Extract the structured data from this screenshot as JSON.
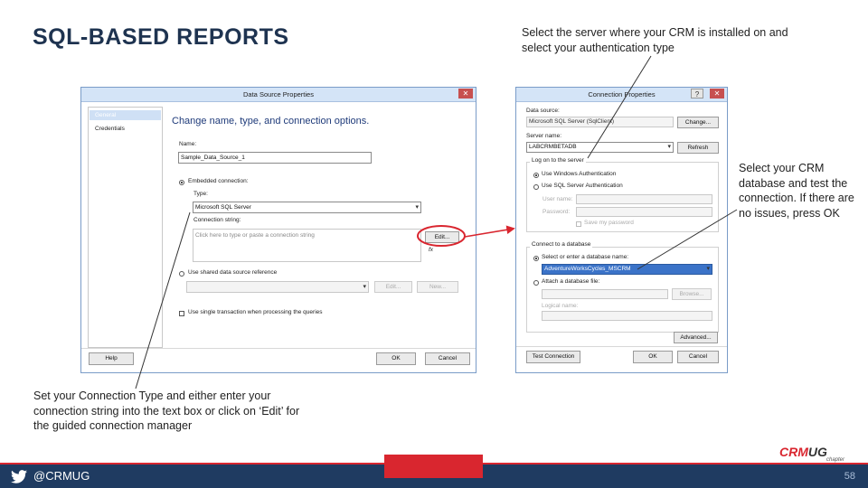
{
  "slide": {
    "title": "SQL-BASED REPORTS",
    "note_top": "Select the server where your CRM is installed on and select your authentication type",
    "note_right": "Select your CRM database and test the connection. If there are no issues, press OK",
    "note_bottom": "Set your Connection Type and either enter your connection string into the text box or click on ‘Edit’ for the guided connection manager",
    "twitter_handle": "@CRMUG",
    "page_number": "58",
    "logo_crm": "CRM",
    "logo_ug": "UG",
    "logo_sub": "chapter",
    "colors": {
      "title": "#1e3350",
      "accent_red": "#d9262f",
      "footer_navy": "#1f3b61",
      "arrow": "#d9262f"
    }
  },
  "dsp": {
    "window_title": "Data Source Properties",
    "close": "✕",
    "nav_items": [
      "General",
      "Credentials"
    ],
    "heading": "Change name, type, and connection options.",
    "name_label": "Name:",
    "name_value": "Sample_Data_Source_1",
    "embedded_label": "Embedded connection:",
    "type_label": "Type:",
    "type_value": "Microsoft SQL Server",
    "conn_label": "Connection string:",
    "conn_placeholder": "Click here to type or paste a connection string",
    "edit_button": "Edit...",
    "fx": "fx",
    "shared_label": "Use shared data source reference",
    "shared_edit": "Edit...",
    "shared_new": "New...",
    "single_txn": "Use single transaction when processing the queries",
    "help": "Help",
    "ok": "OK",
    "cancel": "Cancel"
  },
  "cp": {
    "window_title": "Connection Properties",
    "help_q": "?",
    "close": "✕",
    "data_source_label": "Data source:",
    "data_source_value": "Microsoft SQL Server (SqlClient)",
    "change": "Change...",
    "server_label": "Server name:",
    "server_value": "LABCRMBETADB",
    "refresh": "Refresh",
    "logon_group": "Log on to the server",
    "use_windows": "Use Windows Authentication",
    "use_sql": "Use SQL Server Authentication",
    "user_name": "User name:",
    "password": "Password:",
    "save_password": "Save my password",
    "connect_group": "Connect to a database",
    "select_db": "Select or enter a database name:",
    "db_value": "AdventureWorksCycles_MSCRM",
    "attach": "Attach a database file:",
    "browse": "Browse...",
    "logical_name": "Logical name:",
    "advanced": "Advanced...",
    "test": "Test Connection",
    "ok": "OK",
    "cancel": "Cancel"
  }
}
